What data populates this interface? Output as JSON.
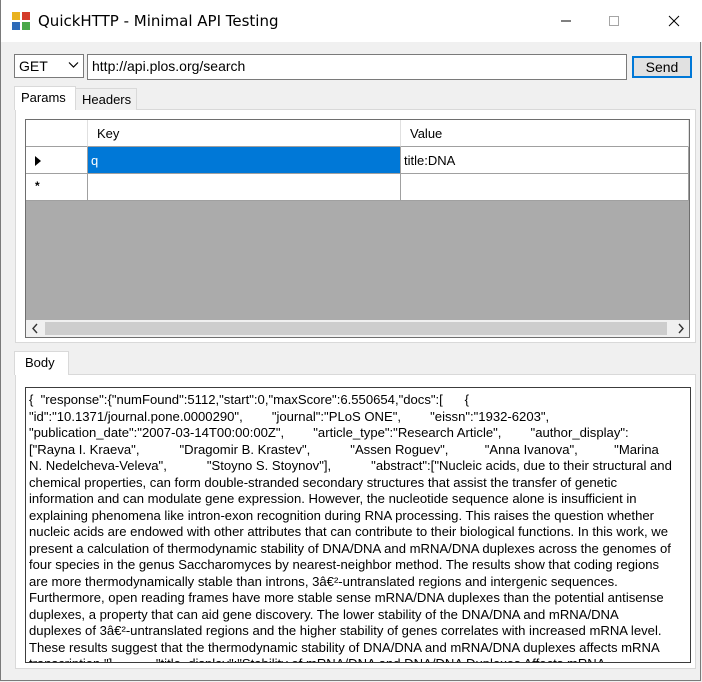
{
  "window": {
    "title": "QuickHTTP - Minimal API Testing"
  },
  "request": {
    "method": "GET",
    "url": "http://api.plos.org/search",
    "send_label": "Send"
  },
  "tabs": [
    {
      "label": "Params",
      "active": true
    },
    {
      "label": "Headers",
      "active": false
    }
  ],
  "params": {
    "columns": [
      "Key",
      "Value"
    ],
    "rows": [
      {
        "key": "q",
        "value": "title:DNA",
        "marker": "current-row"
      },
      {
        "key": "",
        "value": "",
        "marker": "new-row"
      }
    ]
  },
  "body_tab": {
    "label": "Body"
  },
  "body": {
    "text": "{  \"response\":{\"numFound\":5112,\"start\":0,\"maxScore\":6.550654,\"docs\":[      {\n\"id\":\"10.1371/journal.pone.0000290\",        \"journal\":\"PLoS ONE\",        \"eissn\":\"1932-6203\",\n\"publication_date\":\"2007-03-14T00:00:00Z\",        \"article_type\":\"Research Article\",        \"author_display\":\n[\"Rayna I. Kraeva\",           \"Dragomir B. Krastev\",           \"Assen Roguev\",          \"Anna Ivanova\",          \"Marina\nN. Nedelcheva-Veleva\",           \"Stoyno S. Stoynov\"],           \"abstract\":[\"Nucleic acids, due to their structural and\nchemical properties, can form double-stranded secondary structures that assist the transfer of genetic\ninformation and can modulate gene expression. However, the nucleotide sequence alone is insufficient in\nexplaining phenomena like intron-exon recognition during RNA processing. This raises the question whether\nnucleic acids are endowed with other attributes that can contribute to their biological functions. In this work, we\npresent a calculation of thermodynamic stability of DNA/DNA and mRNA/DNA duplexes across the genomes of\nfour species in the genus Saccharomyces by nearest-neighbor method. The results show that coding regions\nare more thermodynamically stable than introns, 3â€²-untranslated regions and intergenic sequences.\nFurthermore, open reading frames have more stable sense mRNA/DNA duplexes than the potential antisense\nduplexes, a property that can aid gene discovery. The lower stability of the DNA/DNA and mRNA/DNA\nduplexes of 3â€²-untranslated regions and the higher stability of genes correlates with increased mRNA level.\nThese results suggest that the thermodynamic stability of DNA/DNA and mRNA/DNA duplexes affects mRNA\ntranscription.\"],           \"title_display\":\"Stability of mRNA/DNA and DNA/DNA Duplexes Affects mRNA"
  },
  "icons": {
    "app": "app-icon",
    "minimize": "minimize-icon",
    "maximize": "maximize-icon",
    "close": "close-icon",
    "dropdown": "chevron-down-icon",
    "row_pointer": "row-pointer-icon",
    "new_row": "new-row-asterisk-icon",
    "scroll_left": "scroll-left-icon",
    "scroll_right": "scroll-right-icon"
  },
  "colors": {
    "accent": "#0078d7",
    "grid_background": "#ababab",
    "window_background": "#f0f0f0"
  }
}
